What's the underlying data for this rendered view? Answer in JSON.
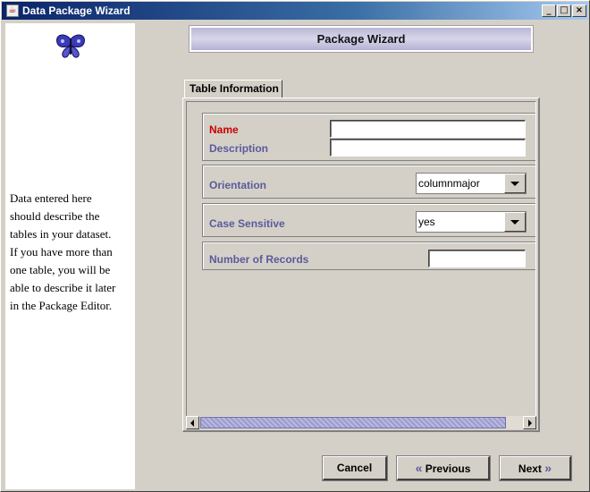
{
  "window": {
    "title": "Data Package Wizard",
    "controls": {
      "minimize": "_",
      "maximize": "□",
      "close": "×"
    }
  },
  "sidebar": {
    "icon": "butterfly-icon",
    "text": " Data entered here\nshould describe the\ntables in your dataset.\nIf you have more than\none table, you will be\nable to describe it later\nin the Package Editor."
  },
  "header": {
    "title": "Package Wizard"
  },
  "tab": {
    "label": "Table Information"
  },
  "form": {
    "name_label": "Name",
    "name_value": "",
    "description_label": "Description",
    "description_value": "",
    "orientation_label": "Orientation",
    "orientation_value": "columnmajor",
    "case_sensitive_label": "Case Sensitive",
    "case_sensitive_value": "yes",
    "records_label": "Number of Records",
    "records_value": ""
  },
  "buttons": {
    "cancel": "Cancel",
    "previous": "Previous",
    "next": "Next",
    "previous_icon": "«",
    "next_icon": "»"
  },
  "colors": {
    "required_label": "#cc0000",
    "field_label": "#5a5a9c",
    "title_bar": "#0a246a",
    "panel": "#d4d0c8"
  }
}
